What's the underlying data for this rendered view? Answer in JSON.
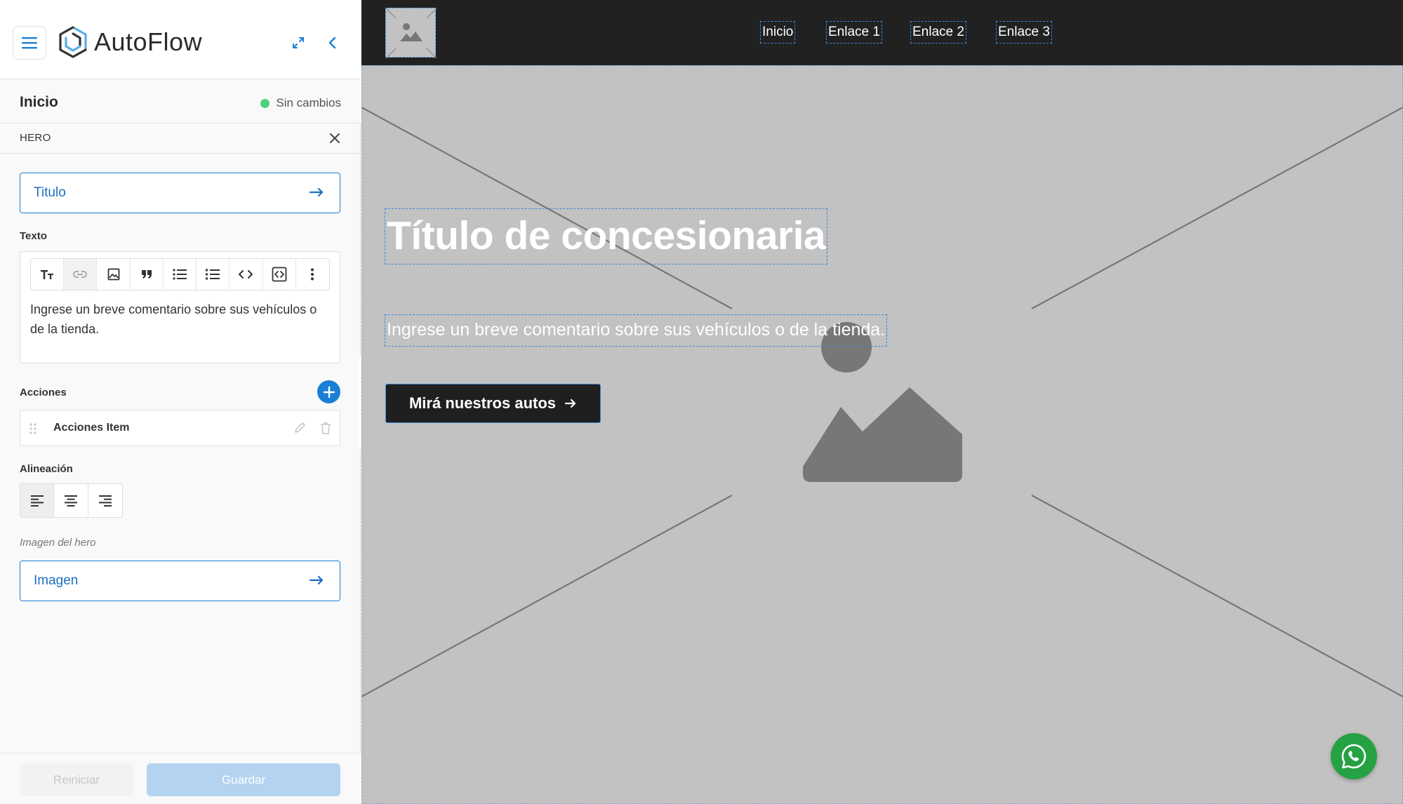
{
  "app": {
    "name": "AutoFlow"
  },
  "sidebar": {
    "page_title": "Inicio",
    "status": "Sin cambios",
    "section": "HERO",
    "title_field": "Titulo",
    "text_label": "Texto",
    "text_content": "Ingrese un breve comentario sobre sus vehículos o de la tienda.",
    "toolbar_icons": [
      "text-size-icon",
      "link-icon",
      "image-icon",
      "quote-icon",
      "bullet-list-icon",
      "ordered-list-icon",
      "code-icon",
      "code-block-icon",
      "more-vertical-icon"
    ],
    "actions_label": "Acciones",
    "action_item": "Acciones Item",
    "alignment_label": "Alineación",
    "alignment_selected": "left",
    "image_hint": "Imagen del hero",
    "image_field": "Imagen",
    "reset_button": "Reiniciar",
    "save_button": "Guardar"
  },
  "preview": {
    "nav_links": [
      "Inicio",
      "Enlace 1",
      "Enlace 2",
      "Enlace 3"
    ],
    "hero_title": "Título de concesionaria",
    "hero_subtitle": "Ingrese un breve comentario sobre sus vehículos o de la tienda.",
    "hero_button": "Mirá nuestros autos"
  },
  "colors": {
    "accent": "#1b7fd4",
    "status_dot": "#4bd37b",
    "navbar_bg": "#212121",
    "hero_placeholder_bg": "#c2c2c2",
    "whatsapp": "#25a244"
  }
}
